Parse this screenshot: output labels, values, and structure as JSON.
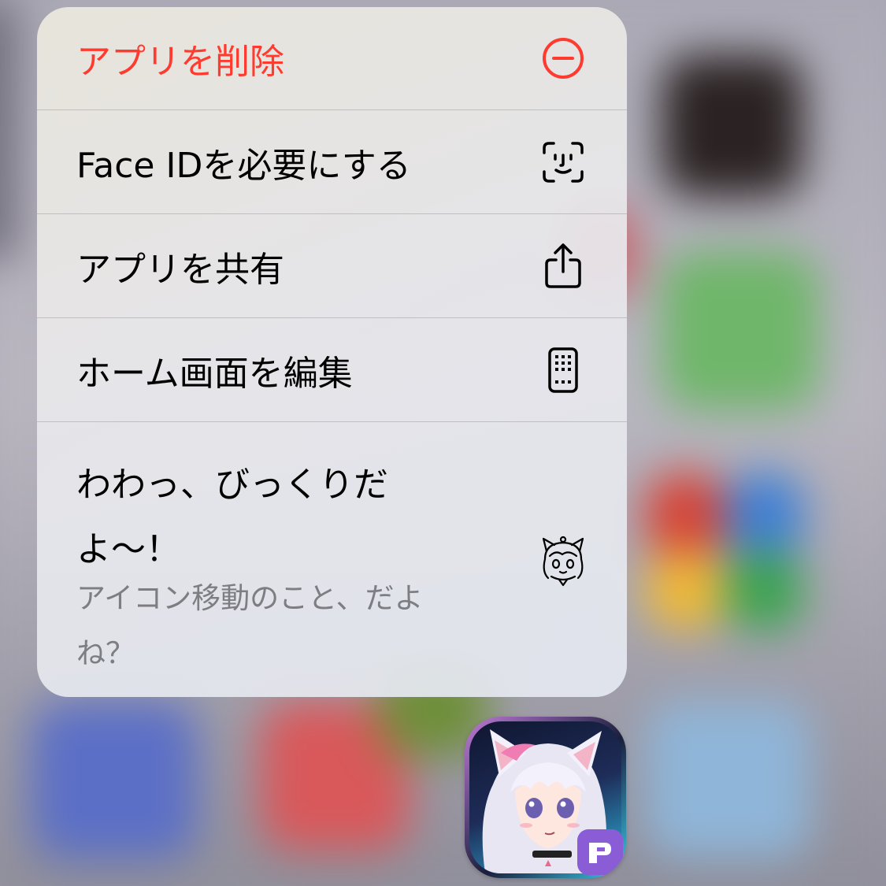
{
  "menu": {
    "items": [
      {
        "label": "アプリを削除",
        "icon": "minus-circle-icon",
        "color": "#ff3b30"
      },
      {
        "label": "Face IDを必要にする",
        "icon": "face-id-icon"
      },
      {
        "label": "アプリを共有",
        "icon": "share-icon"
      },
      {
        "label": "ホーム画面を編集",
        "icon": "phone-apps-icon"
      }
    ],
    "widget_item": {
      "title": "わわっ、びっくりだよ〜！",
      "subtitle": "アイコン移動のこと、だよね？",
      "icon": "anime-character-icon"
    }
  },
  "app_icon": {
    "icon": "anime-girl-app-icon",
    "badge": "p-badge-icon"
  }
}
